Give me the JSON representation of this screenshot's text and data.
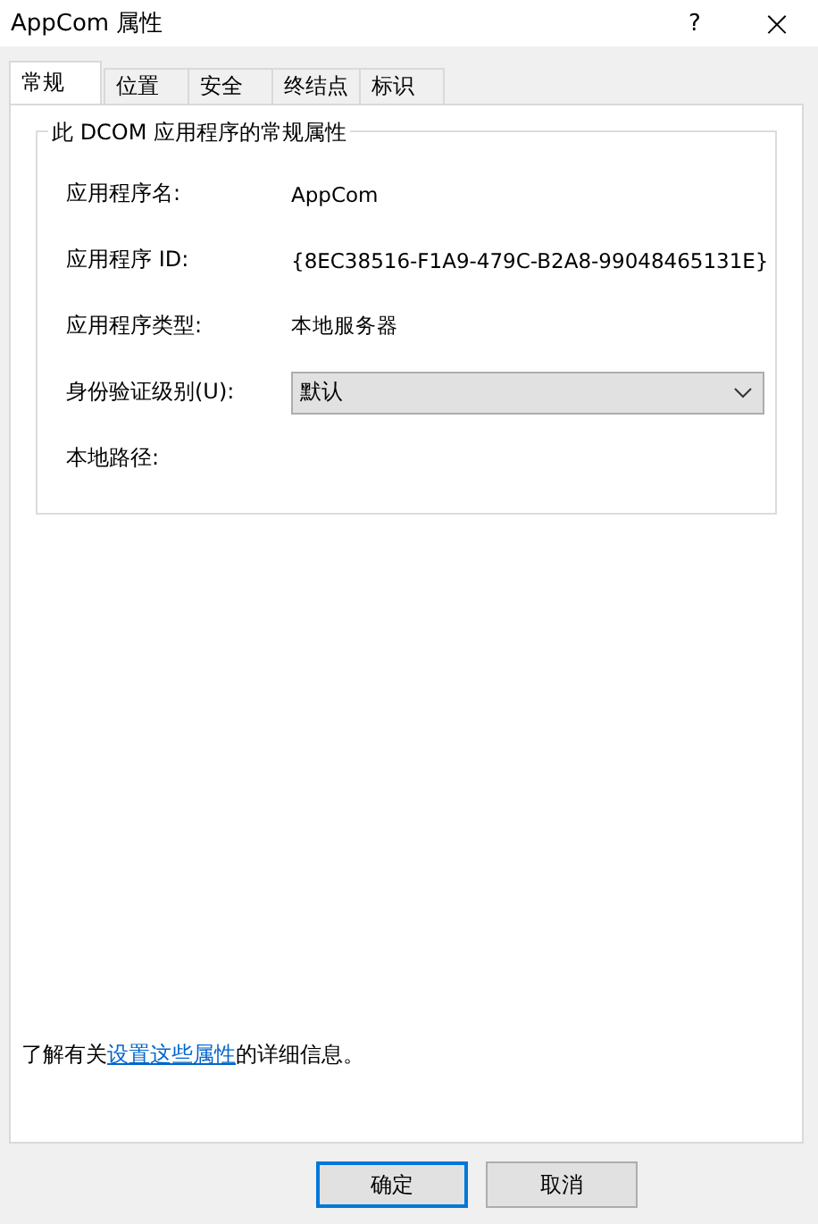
{
  "window": {
    "title": "AppCom 属性",
    "help": "?",
    "close": "×"
  },
  "tabs": [
    {
      "label": "常规",
      "selected": true
    },
    {
      "label": "位置",
      "selected": false
    },
    {
      "label": "安全",
      "selected": false
    },
    {
      "label": "终结点",
      "selected": false
    },
    {
      "label": "标识",
      "selected": false
    }
  ],
  "group": {
    "title": "此 DCOM 应用程序的常规属性",
    "rows": [
      {
        "kind": "text",
        "label": "应用程序名:",
        "value": "AppCom"
      },
      {
        "kind": "text",
        "label": "应用程序 ID:",
        "value": "{8EC38516-F1A9-479C-B2A8-99048465131E}"
      },
      {
        "kind": "text",
        "label": "应用程序类型:",
        "value": "本地服务器"
      },
      {
        "kind": "dropdown",
        "label": "身份验证级别(U):",
        "value": "默认"
      },
      {
        "kind": "text",
        "label": "本地路径:"
      }
    ]
  },
  "info": {
    "before": "了解有关",
    "link": "设置这些属性",
    "after": "的详细信息。"
  },
  "buttons": [
    {
      "label": "确定",
      "default": true
    },
    {
      "label": "取消",
      "default": false
    }
  ]
}
